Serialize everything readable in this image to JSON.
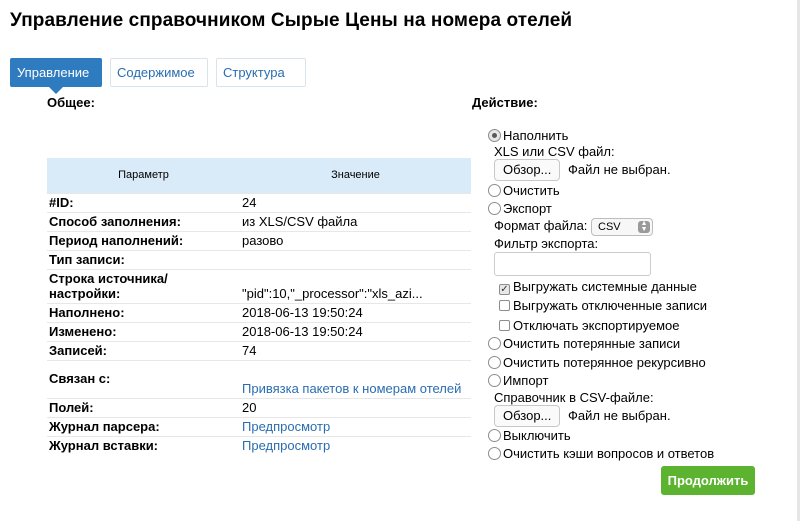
{
  "page_title": "Управление справочником Сырые Цены на номера отелей",
  "tabs": [
    {
      "label": "Управление"
    },
    {
      "label": "Содержимое"
    },
    {
      "label": "Структура"
    }
  ],
  "general": {
    "title": "Общее:",
    "columns": {
      "param": "Параметр",
      "value": "Значение"
    },
    "rows": [
      {
        "key": "#ID:",
        "value": "24"
      },
      {
        "key": "Способ заполнения:",
        "value": "из XLS/CSV файла"
      },
      {
        "key": "Период наполнений:",
        "value": "разово"
      },
      {
        "key": "Тип записи:",
        "value": ""
      },
      {
        "key": "Строка источника/настройки:",
        "value": "\"pid\":10,\"_processor\":\"xls_azi..."
      },
      {
        "key": "Наполнено:",
        "value": "2018-06-13 19:50:24"
      },
      {
        "key": "Изменено:",
        "value": "2018-06-13 19:50:24"
      },
      {
        "key": "Записей:",
        "value": "74"
      },
      {
        "key": "Связан с:",
        "value": "Привязка пакетов к номерам отелей"
      },
      {
        "key": "Полей:",
        "value": "20"
      },
      {
        "key": "Журнал парсера:",
        "value": "Предпросмотр"
      },
      {
        "key": "Журнал вставки:",
        "value": "Предпросмотр"
      }
    ]
  },
  "actions": {
    "title": "Действие:",
    "fill": "Наполнить",
    "file_label": "XLS или CSV файл:",
    "browse": "Обзор...",
    "no_file": "Файл не выбран.",
    "clear": "Очистить",
    "export": "Экспорт",
    "file_format_label": "Формат файла:",
    "file_format_value": "CSV",
    "export_filter_label": "Фильтр экспорта:",
    "export_filter_value": "",
    "export_system": "Выгружать системные данные",
    "export_disabled": "Выгружать отключенные записи",
    "disable_exported": "Отключать экспортируемое",
    "clear_lost": "Очистить потерянные записи",
    "clear_lost_recursive": "Очистить потерянное рекурсивно",
    "import": "Импорт",
    "csv_dictionary_label": "Справочник в CSV-файле:",
    "browse2": "Обзор...",
    "no_file2": "Файл не выбран.",
    "disable": "Выключить",
    "clear_cache": "Очистить кэши вопросов и ответов",
    "submit": "Продолжить"
  }
}
